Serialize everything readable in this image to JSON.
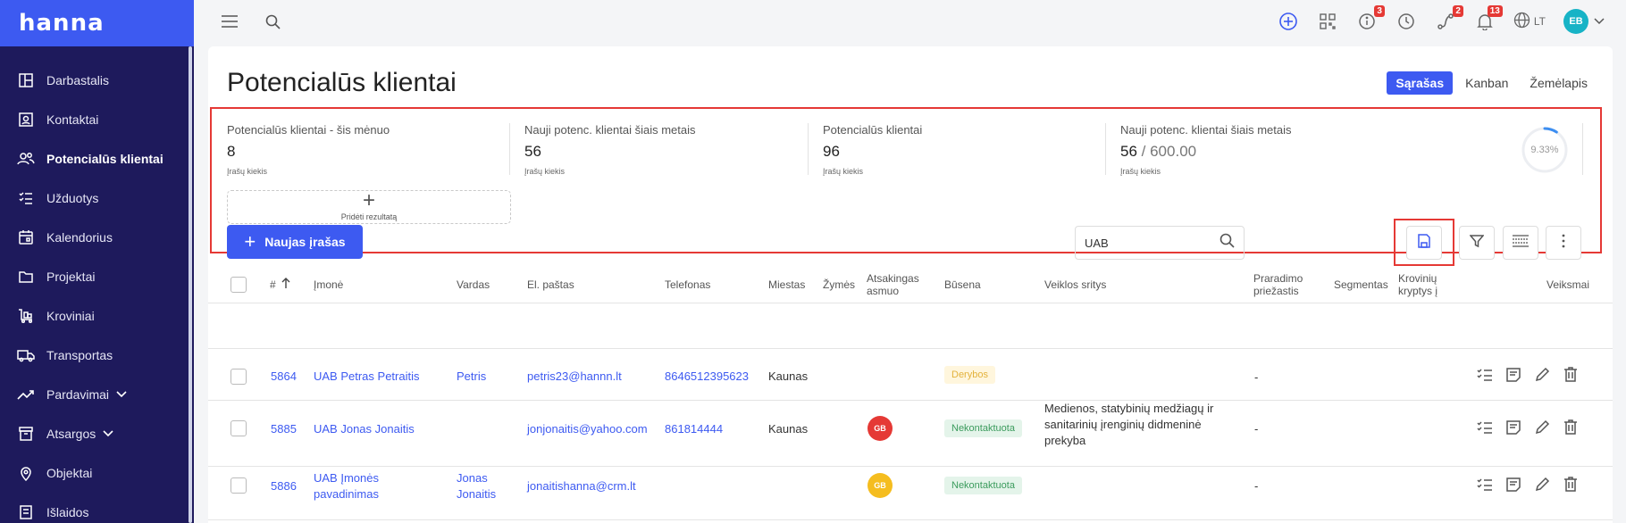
{
  "brand": "hanna",
  "sidebar": {
    "items": [
      {
        "label": "Darbastalis",
        "icon": "dashboard-icon"
      },
      {
        "label": "Kontaktai",
        "icon": "contacts-icon"
      },
      {
        "label": "Potencialūs klientai",
        "icon": "leads-icon",
        "active": true
      },
      {
        "label": "Užduotys",
        "icon": "tasks-icon"
      },
      {
        "label": "Kalendorius",
        "icon": "calendar-icon"
      },
      {
        "label": "Projektai",
        "icon": "folder-icon"
      },
      {
        "label": "Kroviniai",
        "icon": "cargo-icon"
      },
      {
        "label": "Transportas",
        "icon": "truck-icon"
      },
      {
        "label": "Pardavimai",
        "icon": "sales-chart-icon"
      },
      {
        "label": "Atsargos",
        "icon": "inventory-icon"
      },
      {
        "label": "Objektai",
        "icon": "location-pin-icon"
      },
      {
        "label": "Išlaidos",
        "icon": "expenses-icon"
      }
    ]
  },
  "topbar": {
    "badges": {
      "info": "3",
      "routes": "2",
      "notifications": "13"
    },
    "language": "LT",
    "avatar": "EB"
  },
  "page": {
    "title": "Potencialūs klientai",
    "views": [
      "Sąrašas",
      "Kanban",
      "Žemėlapis"
    ]
  },
  "stats": [
    {
      "label": "Potencialūs klientai - šis mėnuo",
      "value": "8",
      "sub": "Įrašų kiekis"
    },
    {
      "label": "Nauji potenc. klientai šiais metais",
      "value": "56",
      "sub": "Įrašų kiekis"
    },
    {
      "label": "Potencialūs klientai",
      "value": "96",
      "sub": "Įrašų kiekis"
    },
    {
      "label": "Nauji potenc. klientai šiais metais",
      "value": "56",
      "target": "/ 600.00",
      "sub": "Įrašų kiekis",
      "percent": "9.33%",
      "fraction": 0.0933
    }
  ],
  "add_result": "Pridėti rezultatą",
  "toolbar": {
    "new_label": "Naujas įrašas",
    "search_value": "UAB"
  },
  "table": {
    "headers": {
      "id": "#",
      "company": "Įmonė",
      "name": "Vardas",
      "email": "El. paštas",
      "phone": "Telefonas",
      "city": "Miestas",
      "tags": "Žymės",
      "responsible": "Atsakingas asmuo",
      "status": "Būsena",
      "activity": "Veiklos sritys",
      "loss": "Praradimo priežastis",
      "segments": "Segmentas",
      "cargo": "Krovinių kryptys į",
      "actions": "Veiksmai"
    },
    "rows": [
      {
        "id": "5864",
        "company": "UAB Petras Petraitis",
        "name": "Petris",
        "email": "petris23@hannn.lt",
        "phone": "8646512395623",
        "city": "Kaunas",
        "responsible": "",
        "status": "Derybos",
        "activity": "",
        "loss": "-"
      },
      {
        "id": "5885",
        "company": "UAB Jonas Jonaitis",
        "name": "",
        "email": "jonjonaitis@yahoo.com",
        "phone": "861814444",
        "city": "Kaunas",
        "responsible": "GB",
        "status": "Nekontaktuota",
        "activity": "Medienos, statybinių medžiagų ir sanitarinių įrenginių didmeninė prekyba",
        "loss": "-"
      },
      {
        "id": "5886",
        "company": "UAB Įmonės pavadinimas",
        "name": "Jonas Jonaitis",
        "email": "jonaitishanna@crm.lt",
        "phone": "",
        "city": "",
        "responsible": "GB",
        "status": "Nekontaktuota",
        "activity": "",
        "loss": "-"
      }
    ]
  },
  "colors": {
    "accent": "#3d5af1",
    "sidebar": "#1e1a5c",
    "highlight": "#e53935"
  }
}
